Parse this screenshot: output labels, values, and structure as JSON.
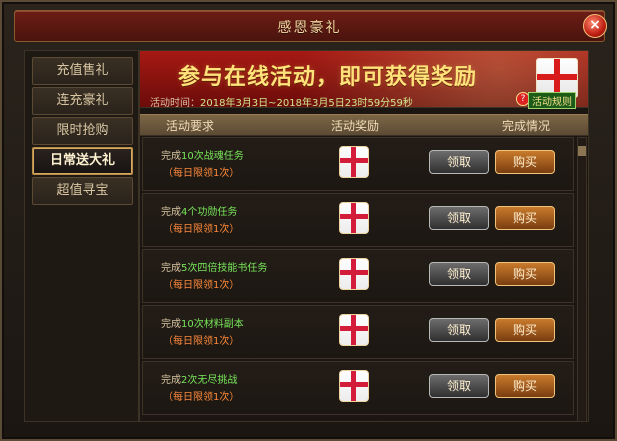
{
  "window": {
    "title": "感恩豪礼"
  },
  "sidebar": {
    "items": [
      {
        "label": "充值售礼"
      },
      {
        "label": "连充豪礼"
      },
      {
        "label": "限时抢购"
      },
      {
        "label": "日常送大礼",
        "active": true
      },
      {
        "label": "超值寻宝"
      }
    ]
  },
  "banner": {
    "title": "参与在线活动，即可获得奖励",
    "time_label": "活动时间：",
    "time_value": "2018年3月3日~2018年3月5日23时59分59秒",
    "info_link": "活动规则"
  },
  "table": {
    "headers": [
      "活动要求",
      "活动奖励",
      "完成情况"
    ],
    "rows": [
      {
        "prefix": "完成",
        "task": "10次战魂任务",
        "limit": "（每日限领1次）"
      },
      {
        "prefix": "完成",
        "task": "4个功勋任务",
        "limit": "（每日限领1次）"
      },
      {
        "prefix": "完成",
        "task": "5次四倍技能书任务",
        "limit": "（每日限领1次）"
      },
      {
        "prefix": "完成",
        "task": "10次材料副本",
        "limit": "（每日限领1次）"
      },
      {
        "prefix": "完成",
        "task": "2次无尽挑战",
        "limit": "（每日限领1次）"
      }
    ],
    "claim_label": "领取",
    "buy_label": "购买"
  },
  "icons": {
    "close": "close-icon",
    "info": "info-icon",
    "gift": "gift-box-icon"
  },
  "colors": {
    "banner_red": "#a61913",
    "banner_text": "#ffe37a",
    "highlight_green": "#78e65a",
    "limit_orange": "#ff8a3a"
  }
}
